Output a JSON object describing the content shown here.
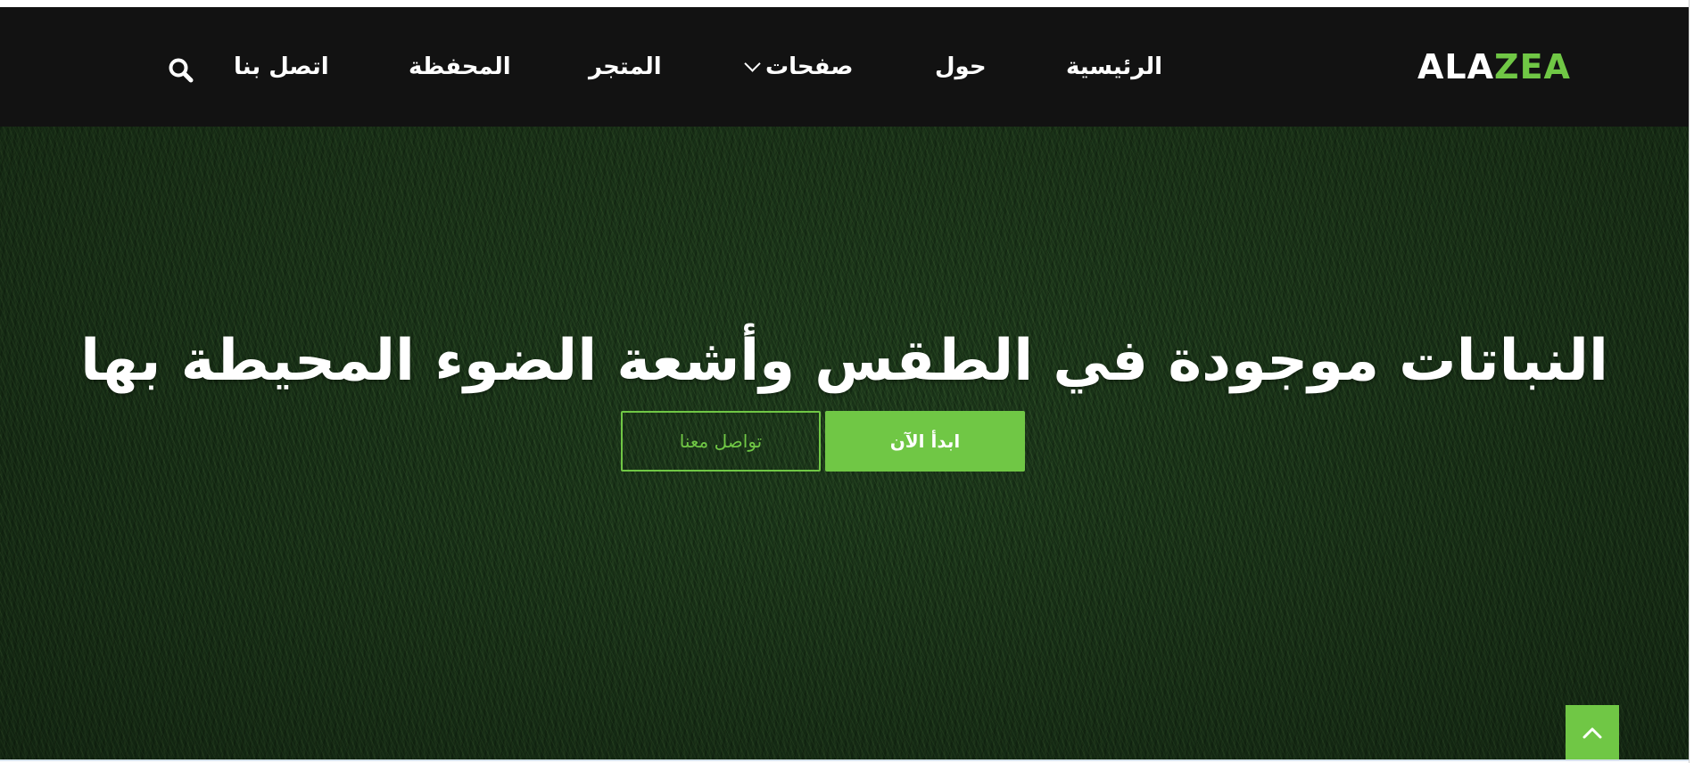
{
  "header": {
    "logo": {
      "part1": "ALA",
      "part2": "ZEA"
    },
    "nav": [
      {
        "label": "الرئيسية"
      },
      {
        "label": "حول"
      },
      {
        "label": "صفحات",
        "has_dropdown": true
      },
      {
        "label": "المتجر"
      },
      {
        "label": "المحفظة"
      },
      {
        "label": "اتصل بنا"
      }
    ],
    "search_icon": "search-icon"
  },
  "hero": {
    "title": "النباتات موجودة في الطقس وأشعة الضوء المحيطة بها",
    "primary_button": "ابدأ الآن",
    "secondary_button": "تواصل معنا",
    "background": "grass-texture"
  },
  "scroll_top_icon": "chevron-up-icon",
  "colors": {
    "accent": "#70c745",
    "header_bg": "#121212",
    "hero_bg": "#1c3a1b",
    "text_light": "#ffffff"
  }
}
